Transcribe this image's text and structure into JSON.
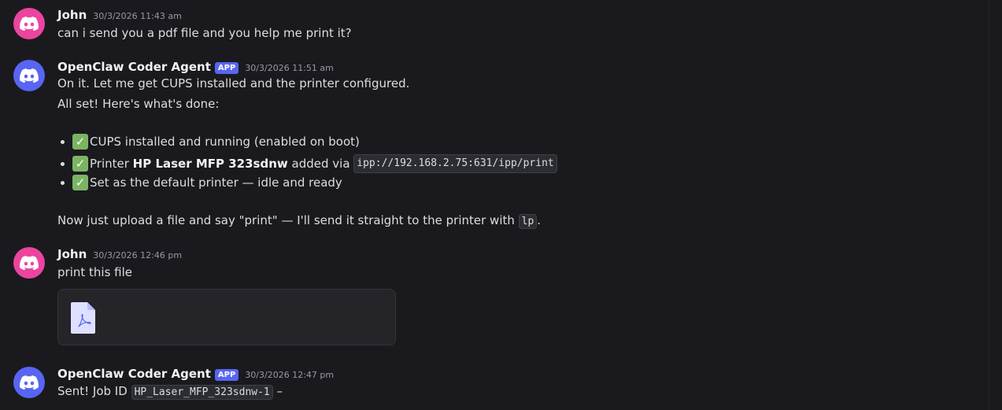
{
  "messages": {
    "m1": {
      "author": "John",
      "timestamp": "30/3/2026 11:43 am",
      "avatar_color": "#eb459f",
      "text": "can i send you a pdf file and you help me print it?"
    },
    "m2": {
      "author": "OpenClaw Coder Agent",
      "tag": "APP",
      "timestamp": "30/3/2026 11:51 am",
      "avatar_color": "#5865f2",
      "line1": "On it. Let me get CUPS installed and the printer configured.",
      "line2": "All set! Here's what's done:",
      "bullets": [
        {
          "icon": "check-mark-icon",
          "text": "CUPS installed and running (enabled on boot)"
        },
        {
          "icon": "check-mark-icon",
          "prefix": "Printer ",
          "bold": "HP Laser MFP 323sdnw",
          "middle": " added via ",
          "code": "ipp://192.168.2.75:631/ipp/print"
        },
        {
          "icon": "check-mark-icon",
          "text": "Set as the default printer — idle and ready"
        }
      ],
      "final_prefix": "Now just upload a file and say \"print\" — I'll send it straight to the printer with ",
      "final_code": "lp",
      "final_suffix": "."
    },
    "m3": {
      "author": "John",
      "timestamp": "30/3/2026 12:46 pm",
      "avatar_color": "#eb459f",
      "text": "print this file",
      "attachment_icon": "pdf-file-icon"
    },
    "m4": {
      "author": "OpenClaw Coder Agent",
      "tag": "APP",
      "timestamp": "30/3/2026 12:47 pm",
      "avatar_color": "#5865f2",
      "prefix": "Sent! Job ID ",
      "code": "HP_Laser_MFP_323sdnw-1",
      "suffix": " –"
    }
  },
  "icons": {
    "avatar": "discord-logo-icon",
    "check": "✓"
  }
}
